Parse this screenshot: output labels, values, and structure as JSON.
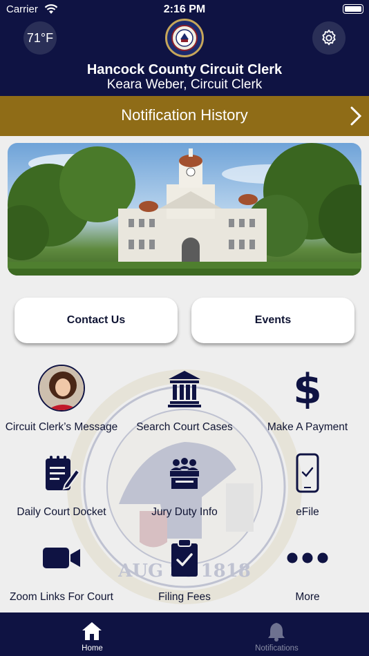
{
  "status_bar": {
    "carrier": "Carrier",
    "time": "2:16 PM"
  },
  "header": {
    "weather": "71°F",
    "title": "Hancock County Circuit Clerk",
    "subtitle": "Keara Weber, Circuit Clerk"
  },
  "notification_bar": {
    "label": "Notification History"
  },
  "buttons": {
    "contact": "Contact Us",
    "events": "Events"
  },
  "grid": [
    {
      "label": "Circuit Clerk’s Message",
      "icon": "clerk-photo"
    },
    {
      "label": "Search Court Cases",
      "icon": "courthouse-icon"
    },
    {
      "label": "Make A Payment",
      "icon": "dollar-icon"
    },
    {
      "label": "Daily Court Docket",
      "icon": "docket-icon"
    },
    {
      "label": "Jury Duty Info",
      "icon": "jury-icon"
    },
    {
      "label": "eFile",
      "icon": "phone-check-icon"
    },
    {
      "label": "Zoom Links For Court",
      "icon": "video-camera-icon"
    },
    {
      "label": "Filing Fees",
      "icon": "clipboard-check-icon"
    },
    {
      "label": "More",
      "icon": "more-dots-icon"
    }
  ],
  "tabs": {
    "home": "Home",
    "notifications": "Notifications"
  },
  "colors": {
    "navy": "#0f1343",
    "gold": "#8f6c17",
    "background": "#eeeeee"
  }
}
